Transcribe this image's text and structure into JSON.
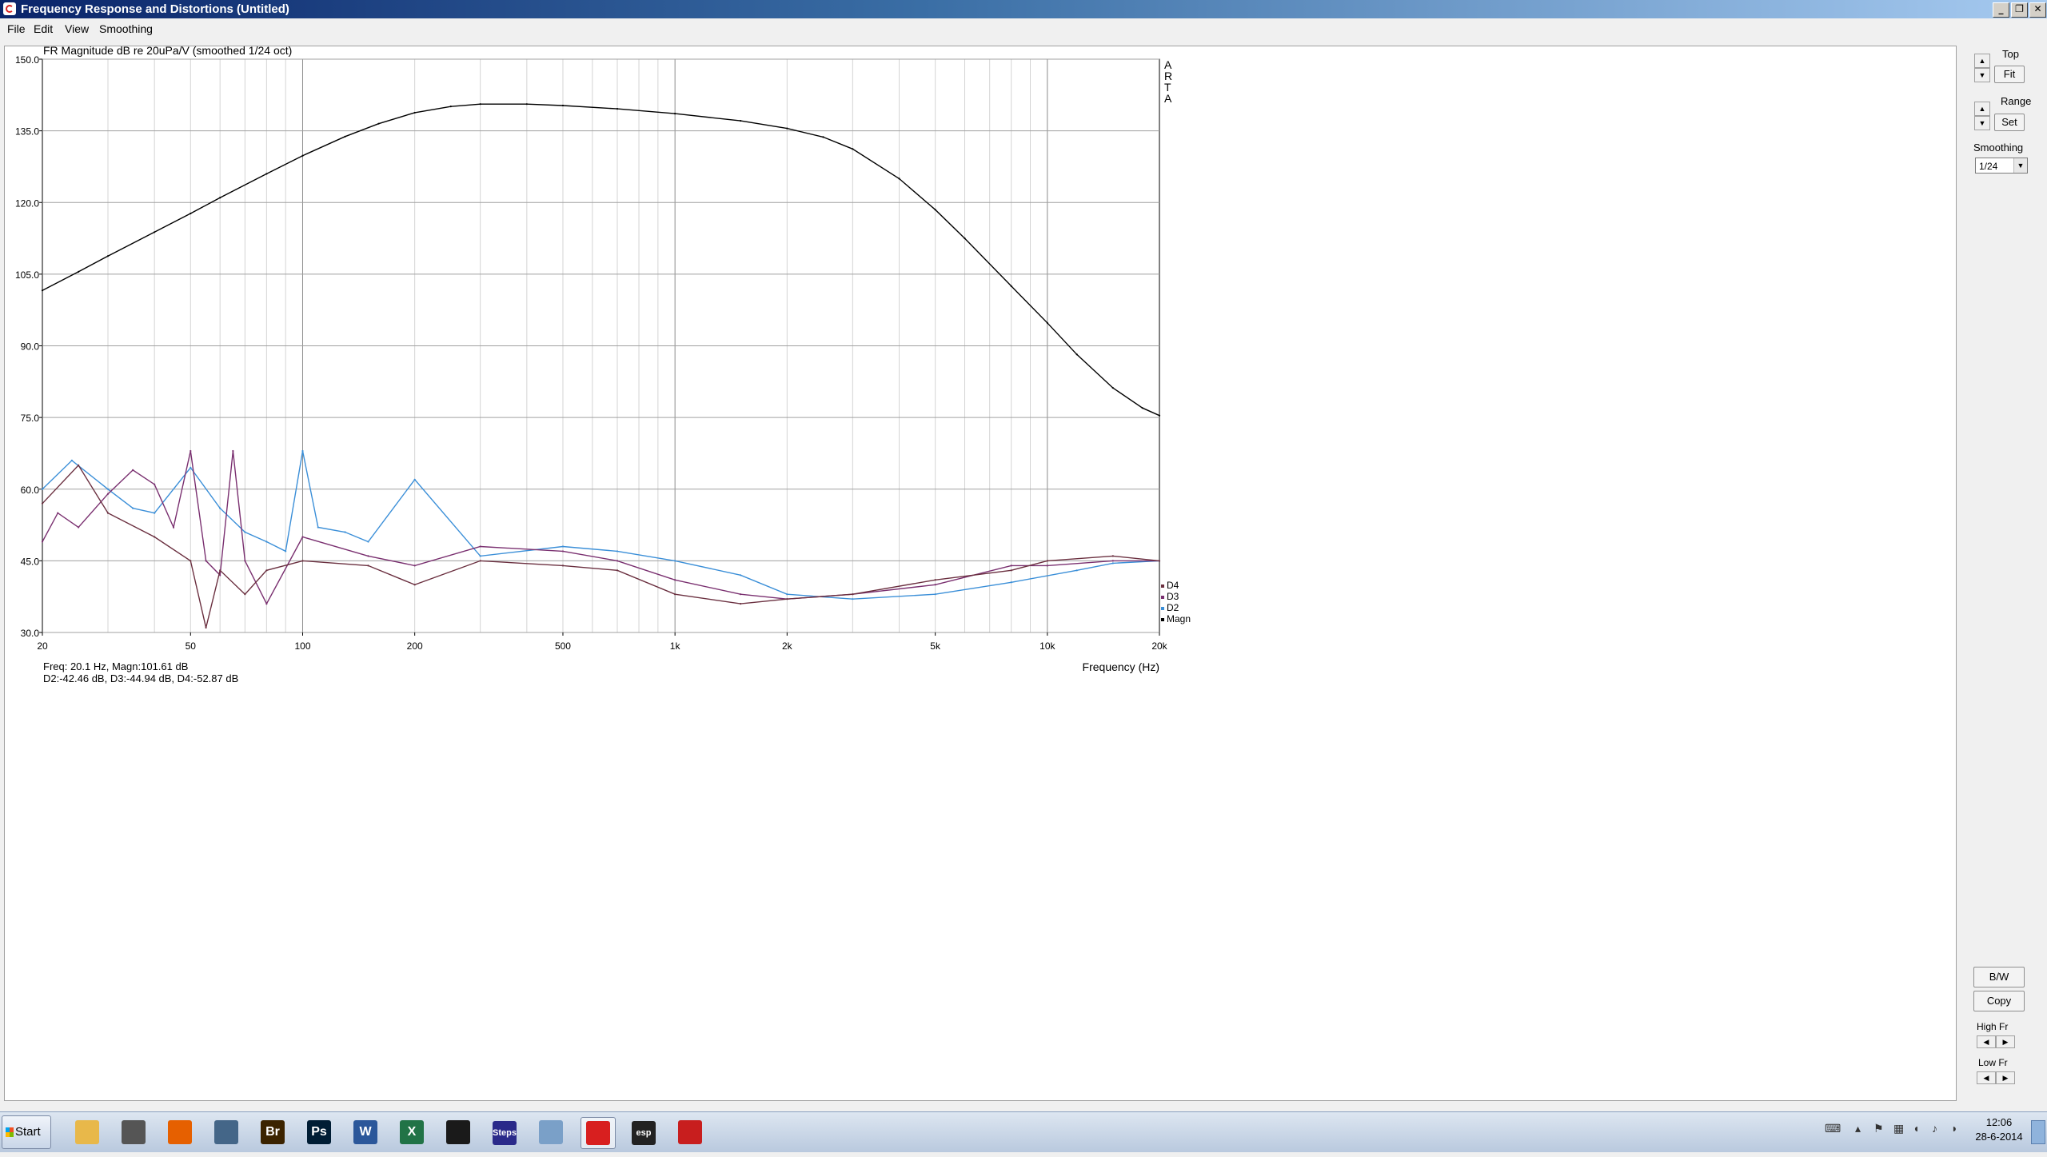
{
  "window": {
    "title": "Frequency Response and Distortions (Untitled)",
    "buttons": [
      "_",
      "❐",
      "✕"
    ]
  },
  "menu": [
    "File",
    "Edit",
    "View",
    "Smoothing"
  ],
  "chart_data": {
    "type": "line",
    "title": "FR Magnitude dB re 20uPa/V (smoothed 1/24 oct)",
    "xlabel": "Frequency (Hz)",
    "x_scale": "log",
    "xlim": [
      20,
      20000
    ],
    "ylim": [
      30,
      150
    ],
    "grid": true,
    "legend_position": "bottom-right",
    "yticks": [
      "150.0",
      "135.0",
      "120.0",
      "105.0",
      "90.0",
      "75.0",
      "60.0",
      "45.0",
      "30.0"
    ],
    "xticks": [
      {
        "v": 20,
        "label": "20"
      },
      {
        "v": 50,
        "label": "50"
      },
      {
        "v": 100,
        "label": "100"
      },
      {
        "v": 200,
        "label": "200"
      },
      {
        "v": 500,
        "label": "500"
      },
      {
        "v": 1000,
        "label": "1k"
      },
      {
        "v": 2000,
        "label": "2k"
      },
      {
        "v": 5000,
        "label": "5k"
      },
      {
        "v": 10000,
        "label": "10k"
      },
      {
        "v": 20000,
        "label": "20k"
      }
    ],
    "watermark": [
      "A",
      "R",
      "T",
      "A"
    ],
    "series": [
      {
        "name": "Magn",
        "color": "#000000",
        "x": [
          20,
          25,
          30,
          40,
          50,
          60,
          80,
          100,
          130,
          160,
          200,
          250,
          300,
          400,
          500,
          700,
          1000,
          1500,
          2000,
          2500,
          3000,
          4000,
          5000,
          6000,
          8000,
          10000,
          12000,
          15000,
          18000,
          20000
        ],
        "y": [
          101.6,
          105.5,
          108.8,
          113.8,
          117.7,
          121,
          126,
          129.8,
          133.8,
          136.5,
          138.8,
          140.1,
          140.6,
          140.6,
          140.3,
          139.6,
          138.6,
          137.1,
          135.5,
          133.7,
          131.2,
          125,
          118.5,
          112.5,
          102.5,
          94.8,
          88.2,
          81.2,
          77,
          75.4
        ]
      },
      {
        "name": "D2",
        "color": "#3b8fd8",
        "x": [
          20,
          24,
          30,
          35,
          40,
          50,
          60,
          70,
          80,
          90,
          100,
          110,
          130,
          150,
          200,
          300,
          500,
          700,
          1000,
          1500,
          2000,
          3000,
          5000,
          8000,
          12000,
          15000,
          20000
        ],
        "y": [
          60,
          66,
          60,
          56,
          55,
          64.5,
          56,
          51,
          49,
          47,
          68,
          52,
          51,
          49,
          62,
          46,
          48,
          47,
          45,
          42,
          38,
          37,
          38,
          40.5,
          43,
          44.5,
          45
        ]
      },
      {
        "name": "D3",
        "color": "#7a3070",
        "x": [
          20,
          22,
          25,
          30,
          35,
          40,
          45,
          50,
          55,
          60,
          65,
          70,
          80,
          100,
          150,
          200,
          300,
          500,
          700,
          1000,
          1500,
          2000,
          3000,
          5000,
          8000,
          10000,
          15000,
          20000
        ],
        "y": [
          49,
          55,
          52,
          59,
          64,
          61,
          52,
          68,
          45,
          42,
          68,
          45,
          36,
          50,
          46,
          44,
          48,
          47,
          45,
          41,
          38,
          37,
          38,
          40,
          44,
          44,
          45,
          45
        ]
      },
      {
        "name": "D4",
        "color": "#6b3040",
        "x": [
          20,
          25,
          30,
          40,
          50,
          55,
          60,
          70,
          80,
          100,
          150,
          200,
          300,
          500,
          700,
          1000,
          1500,
          2000,
          3000,
          5000,
          8000,
          10000,
          15000,
          20000
        ],
        "y": [
          57,
          65,
          55,
          50,
          45,
          31,
          43,
          38,
          43,
          45,
          44,
          40,
          45,
          44,
          43,
          38,
          36,
          37,
          38,
          41,
          43,
          45,
          46,
          45
        ]
      }
    ]
  },
  "readout": {
    "line1": "Freq: 20.1 Hz, Magn:101.61 dB",
    "line2": "D2:-42.46 dB, D3:-44.94 dB, D4:-52.87 dB"
  },
  "side": {
    "top_label": "Top",
    "fit_label": "Fit",
    "range_label": "Range",
    "set_label": "Set",
    "smoothing_label": "Smoothing",
    "smoothing_value": "1/24",
    "bw_label": "B/W",
    "copy_label": "Copy",
    "highfr_label": "High Fr",
    "lowfr_label": "Low Fr"
  },
  "taskbar": {
    "start_label": "Start",
    "apps": [
      {
        "icon": "folder-icon",
        "label": "",
        "color": "#e8b84a"
      },
      {
        "icon": "media-icon",
        "label": "",
        "color": "#555555"
      },
      {
        "icon": "firefox-icon",
        "label": "",
        "color": "#e66000"
      },
      {
        "icon": "scan-icon",
        "label": "",
        "color": "#446688"
      },
      {
        "icon": "bridge-icon",
        "label": "Br",
        "color": "#3b2300"
      },
      {
        "icon": "photoshop-icon",
        "label": "Ps",
        "color": "#001d34"
      },
      {
        "icon": "word-icon",
        "label": "W",
        "color": "#2b579a"
      },
      {
        "icon": "excel-icon",
        "label": "X",
        "color": "#217346"
      },
      {
        "icon": "scope-icon",
        "label": "",
        "color": "#1a1a1a"
      },
      {
        "icon": "steps-icon",
        "label": "Steps",
        "color": "#2a2a8a"
      },
      {
        "icon": "calculator-icon",
        "label": "",
        "color": "#7aa0c8"
      },
      {
        "icon": "arta-icon",
        "label": "",
        "color": "#d81f1f"
      },
      {
        "icon": "esp-icon",
        "label": "esp",
        "color": "#222222"
      },
      {
        "icon": "ltspice-icon",
        "label": "",
        "color": "#c81e1e"
      }
    ],
    "clock_time": "12:06",
    "clock_date": "28-6-2014"
  }
}
